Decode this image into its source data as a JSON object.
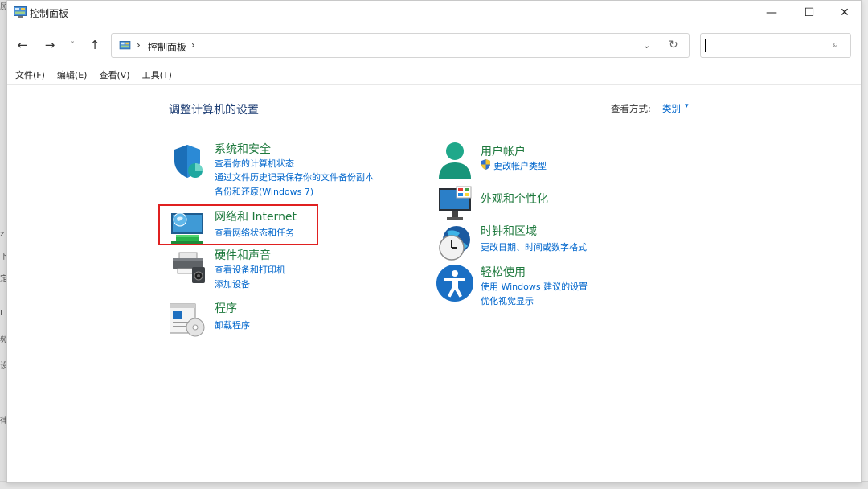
{
  "window": {
    "title": "控制面板"
  },
  "titlebar_buttons": {
    "minimize": "—",
    "maximize": "☐",
    "close": "✕"
  },
  "nav": {
    "back": "←",
    "forward": "→",
    "recent": "˅",
    "up": "↑"
  },
  "address": {
    "separator": "›",
    "location": "控制面板",
    "dropdown": "⌄",
    "refresh": "↻"
  },
  "search": {
    "placeholder": "",
    "icon": "⌕"
  },
  "menu": [
    "文件(F)",
    "编辑(E)",
    "查看(V)",
    "工具(T)"
  ],
  "main": {
    "heading": "调整计算机的设置",
    "view_by_label": "查看方式:",
    "view_by_value": "类别",
    "view_by_caret": "▾"
  },
  "categories": {
    "system_security": {
      "title": "系统和安全",
      "links": [
        "查看你的计算机状态",
        "通过文件历史记录保存你的文件备份副本",
        "备份和还原(Windows 7)"
      ],
      "icon": "shield-icon"
    },
    "network": {
      "title": "网络和 Internet",
      "links": [
        "查看网络状态和任务"
      ],
      "icon": "network-globe-icon"
    },
    "hardware": {
      "title": "硬件和声音",
      "links": [
        "查看设备和打印机",
        "添加设备"
      ],
      "icon": "printer-speaker-icon"
    },
    "programs": {
      "title": "程序",
      "links": [
        "卸载程序"
      ],
      "icon": "programs-disc-icon"
    },
    "user_accounts": {
      "title": "用户帐户",
      "links": [
        "更改帐户类型"
      ],
      "icon": "user-icon"
    },
    "appearance": {
      "title": "外观和个性化",
      "links": [],
      "icon": "monitor-icon"
    },
    "clock_region": {
      "title": "时钟和区域",
      "links": [
        "更改日期、时间或数字格式"
      ],
      "icon": "clock-globe-icon"
    },
    "ease_access": {
      "title": "轻松使用",
      "links": [
        "使用 Windows 建议的设置",
        "优化视觉显示"
      ],
      "icon": "accessibility-icon"
    }
  },
  "colors": {
    "category_title": "#1f7a3e",
    "link": "#0066cc",
    "highlight": "#e02020",
    "heading": "#1e3e74"
  }
}
